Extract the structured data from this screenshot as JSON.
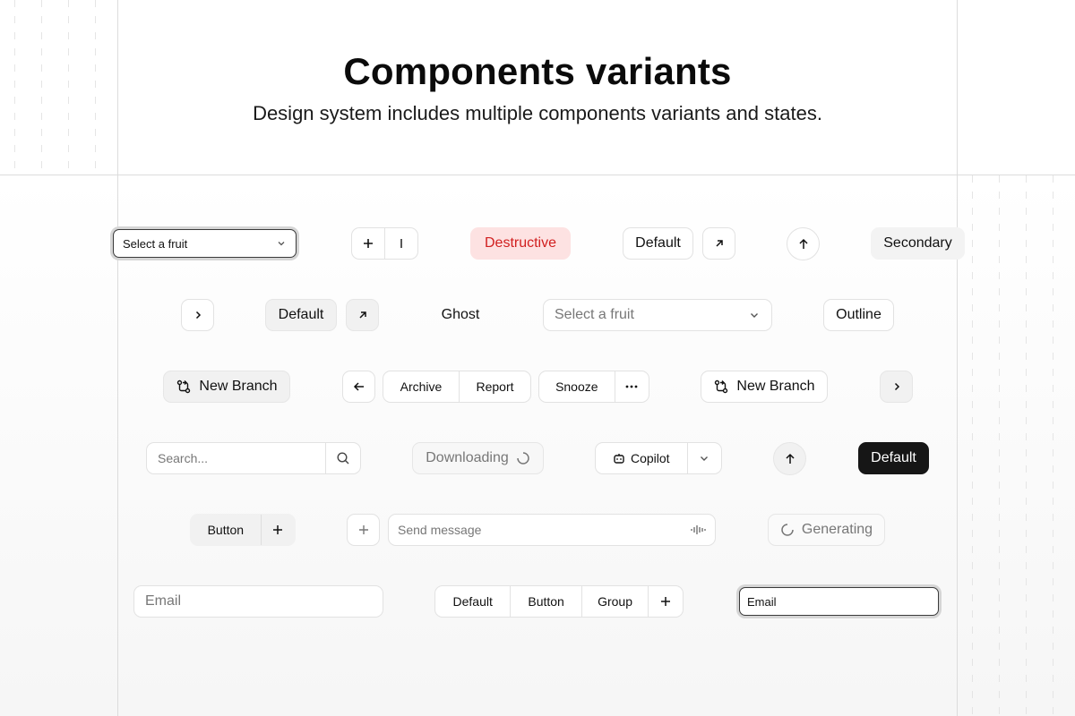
{
  "header": {
    "title": "Components variants",
    "subtitle": "Design system includes multiple components variants and states."
  },
  "row1": {
    "select_focus_value": "Select a fruit",
    "destructive_label": "Destructive",
    "default_label": "Default",
    "secondary_label": "Secondary"
  },
  "row2": {
    "default_label": "Default",
    "ghost_label": "Ghost",
    "select_placeholder": "Select a fruit",
    "outline_label": "Outline"
  },
  "row3": {
    "new_branch_label": "New Branch",
    "archive_label": "Archive",
    "report_label": "Report",
    "snooze_label": "Snooze",
    "new_branch_outline_label": "New Branch"
  },
  "row4": {
    "search_placeholder": "Search...",
    "downloading_label": "Downloading",
    "copilot_label": "Copilot",
    "default_dark_label": "Default"
  },
  "row5": {
    "button_label": "Button",
    "send_placeholder": "Send message",
    "generating_label": "Generating"
  },
  "row6": {
    "email_placeholder": "Email",
    "group_default_label": "Default",
    "group_button_label": "Button",
    "group_group_label": "Group",
    "email_focus_value": "Email"
  },
  "colors": {
    "destructive_bg": "#fde2e2",
    "destructive_text": "#d11f1f",
    "dark_bg": "#161616"
  }
}
